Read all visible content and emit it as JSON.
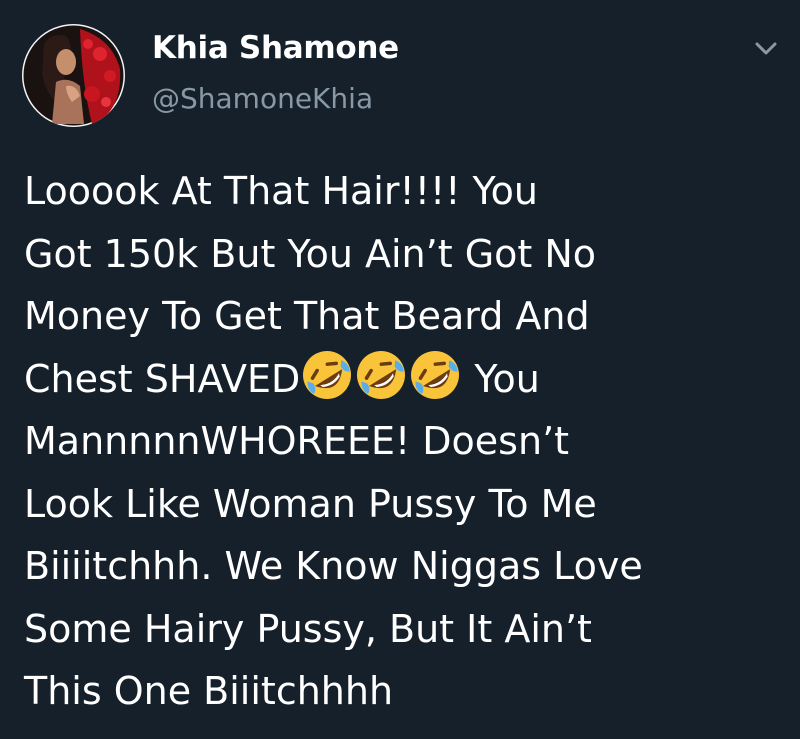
{
  "tweet": {
    "author": {
      "display_name": "Khia Shamone",
      "handle": "@ShamoneKhia"
    },
    "menu_icon": "chevron-down-icon",
    "emoji_name": "rolling-on-the-floor-laughing",
    "body_lines": {
      "l1": "Looook At That Hair!!!!  You",
      "l2": "Got 150k But You Ain’t Got No",
      "l3": "Money To Get That Beard And",
      "l4a": "Chest SHAVED",
      "l4b": " You",
      "l5": "MannnnnWHOREEE! Doesn’t",
      "l6": "Look Like Woman Pussy To Me",
      "l7": "Biiiitchhh. We Know Niggas Love",
      "l8": "Some Hairy Pussy, But It Ain’t",
      "l9": "This One Biiitchhhh"
    }
  },
  "colors": {
    "background": "#15202b",
    "primary_text": "#ffffff",
    "secondary_text": "#8899a6",
    "emoji_face": "#f9c33a",
    "emoji_tear": "#5aaee8"
  }
}
